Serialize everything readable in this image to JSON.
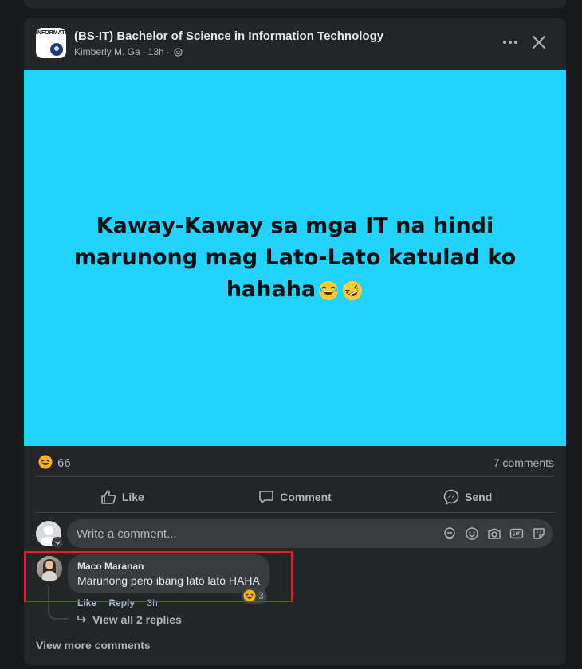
{
  "post": {
    "group_name": "(BS-IT) Bachelor of Science in Information Technology",
    "author": "Kimberly M. Ga",
    "time": "13h",
    "group_logo_text": "INFORMATION TECHNOLOGY",
    "image_text": "Kaway-Kaway sa mga IT na hindi marunong mag Lato-Lato katulad ko hahaha",
    "reaction_count": "66",
    "comment_count": "7 comments"
  },
  "actions": {
    "like": "Like",
    "comment": "Comment",
    "send": "Send"
  },
  "composer": {
    "placeholder": "Write a comment..."
  },
  "comment": {
    "author": "Maco Maranan",
    "text": "Marunong pero ibang lato lato HAHA",
    "like": "Like",
    "reply": "Reply",
    "time": "3h",
    "reaction_count": "3",
    "view_replies": "View all 2 replies"
  },
  "footer": {
    "view_more": "View more comments"
  },
  "colors": {
    "background": "#18191a",
    "card": "#242526",
    "image_bg": "#24d2fe",
    "highlight": "#e41e26"
  },
  "icons": [
    "globe-icon",
    "more-icon",
    "close-icon",
    "haha-icon",
    "like-icon",
    "comment-icon",
    "messenger-icon",
    "sticker-icon",
    "emoji-icon",
    "camera-icon",
    "gif-icon"
  ]
}
